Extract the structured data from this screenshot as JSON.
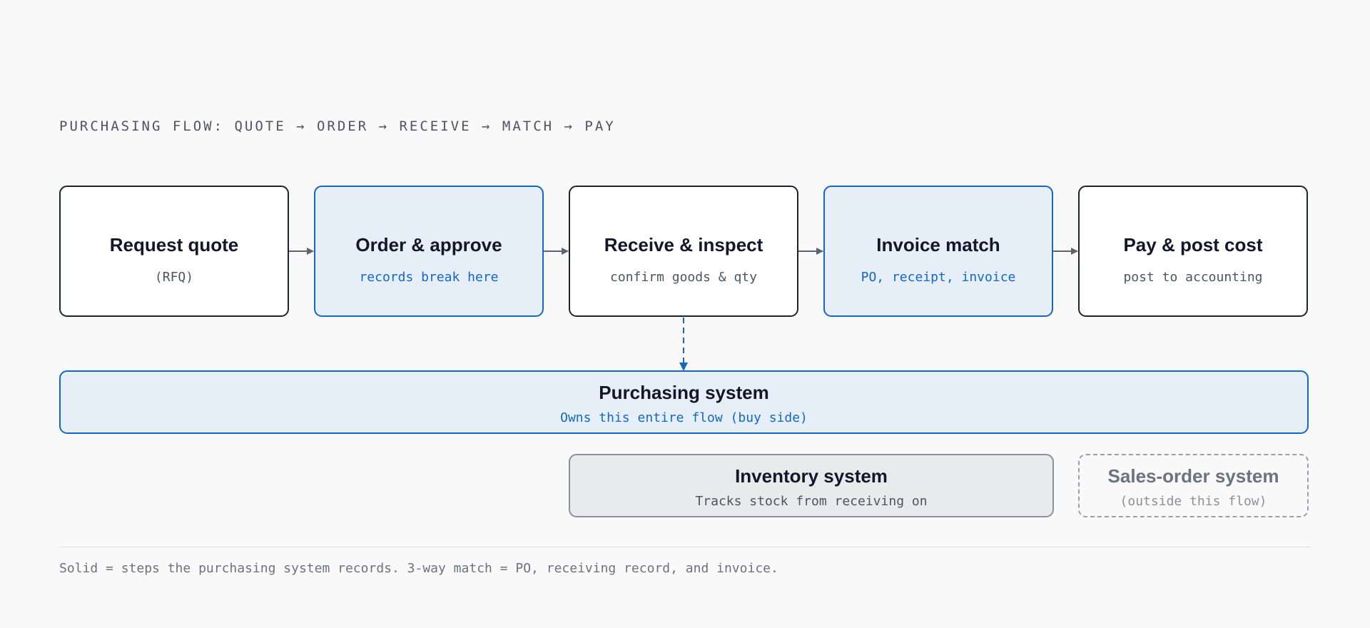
{
  "heading": "PURCHASING FLOW: QUOTE → ORDER → RECEIVE → MATCH → PAY",
  "steps": [
    {
      "title": "Request quote",
      "subtitle": "(RFQ)"
    },
    {
      "title": "Order & approve",
      "subtitle": "records break here"
    },
    {
      "title": "Receive & inspect",
      "subtitle": "confirm goods & qty"
    },
    {
      "title": "Invoice match",
      "subtitle": "PO, receipt, invoice"
    },
    {
      "title": "Pay & post cost",
      "subtitle": "post to accounting"
    }
  ],
  "systems": {
    "purchasing": {
      "title": "Purchasing system",
      "subtitle": "Owns this entire flow (buy side)"
    },
    "inventory": {
      "title": "Inventory system",
      "subtitle": "Tracks stock from receiving on"
    },
    "sales_order": {
      "title": "Sales-order system",
      "subtitle": "(outside this flow)"
    }
  },
  "footnote": "Solid = steps the purchasing system records. 3-way match = PO, receiving record, and invoice.",
  "colors": {
    "highlight": "#1667c4",
    "highlight_fill": "#e6eef7",
    "ink": "#12172a",
    "muted": "#4b5563",
    "connector": "#5b6472"
  }
}
